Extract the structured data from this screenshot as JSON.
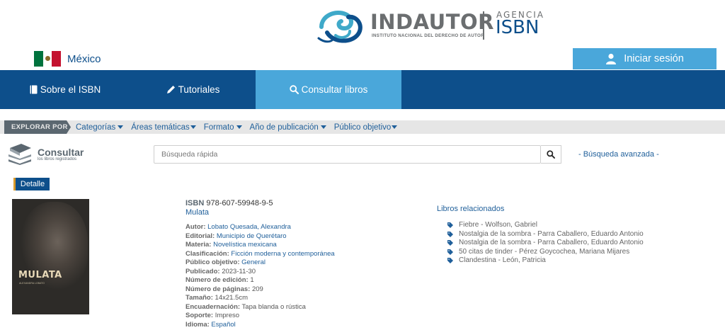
{
  "header": {
    "logo": {
      "brand": "INDAUTOR",
      "tagline": "INSTITUTO NACIONAL DEL DERECHO DE AUTOR",
      "agency": "AGENCIA",
      "isbn": "ISBN"
    },
    "country": "México",
    "login_label": "Iniciar sesión"
  },
  "nav": {
    "items": [
      {
        "label": "Sobre el ISBN",
        "icon": "book-icon"
      },
      {
        "label": "Tutoriales",
        "icon": "pencil-icon"
      },
      {
        "label": "Consultar libros",
        "icon": "search-icon",
        "active": true
      }
    ]
  },
  "explore": {
    "label": "EXPLORAR POR",
    "items": [
      {
        "label": "Categorías"
      },
      {
        "label": "Áreas temáticas"
      },
      {
        "label": "Formato"
      },
      {
        "label": "Año de publicación"
      },
      {
        "label": "Público objetivo"
      }
    ]
  },
  "search": {
    "consult_title": "Consultar",
    "consult_sub": "los libros registrados",
    "placeholder": "Búsqueda rápida",
    "advanced": "- Búsqueda avanzada -"
  },
  "detail": {
    "tag": "Detalle",
    "cover": {
      "title": "MULATA",
      "author": "ALEXANDRA LOBATO"
    },
    "isbn_label": "ISBN",
    "isbn": "978-607-59948-9-5",
    "title": "Mulata",
    "meta": [
      {
        "key": "Autor:",
        "value": "Lobato Quesada, Alexandra",
        "link": true
      },
      {
        "key": "Editorial:",
        "value": "Municipio de Querétaro",
        "link": true
      },
      {
        "key": "Materia:",
        "value": "Novelística mexicana",
        "link": true
      },
      {
        "key": "Clasificación:",
        "value": "Ficción moderna y contemporánea",
        "link": true
      },
      {
        "key": "Público objetivo:",
        "value": "General",
        "link": true
      },
      {
        "key": "Publicado:",
        "value": "2023-11-30",
        "link": false
      },
      {
        "key": "Número de edición:",
        "value": "1",
        "link": false
      },
      {
        "key": "Número de páginas:",
        "value": "209",
        "link": false
      },
      {
        "key": "Tamaño:",
        "value": "14x21.5cm",
        "link": false
      },
      {
        "key": "Encuadernación:",
        "value": "Tapa blanda o rústica",
        "link": false
      },
      {
        "key": "Soporte:",
        "value": "Impreso",
        "link": false
      },
      {
        "key": "Idioma:",
        "value": "Español",
        "link": true
      }
    ]
  },
  "related": {
    "title": "Libros relacionados",
    "items": [
      "Fiebre - Wolfson, Gabriel",
      "Nostalgia de la sombra - Parra Caballero, Eduardo Antonio",
      "Nostalgia de la sombra - Parra Caballero, Eduardo Antonio",
      "50 citas de tinder - Pérez Goycochea, Mariana Mijares",
      "Clandestina - León, Patricia"
    ]
  },
  "colors": {
    "primary": "#0d4f8b",
    "accent": "#4aa7da",
    "link": "#1f5f9a"
  }
}
